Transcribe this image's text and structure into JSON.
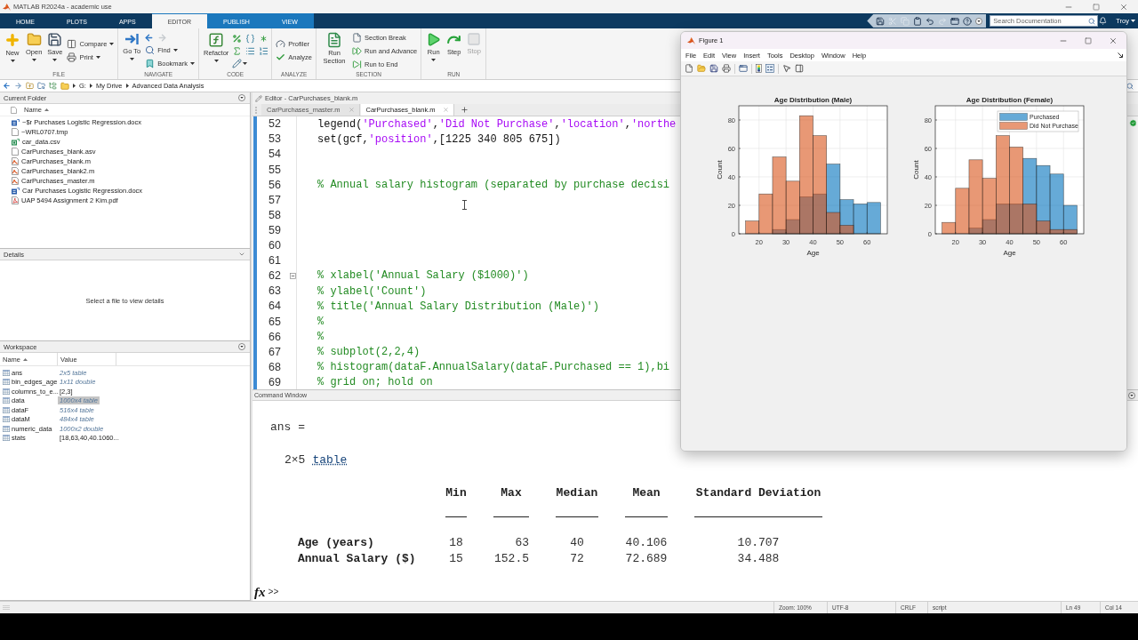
{
  "app_title": "MATLAB R2024a - academic use",
  "ribbon_tabs": [
    {
      "label": "HOME",
      "selected": false,
      "contextual": false
    },
    {
      "label": "PLOTS",
      "selected": false,
      "contextual": false
    },
    {
      "label": "APPS",
      "selected": false,
      "contextual": false
    },
    {
      "label": "EDITOR",
      "selected": true,
      "contextual": true
    },
    {
      "label": "PUBLISH",
      "selected": false,
      "contextual": true
    },
    {
      "label": "VIEW",
      "selected": false,
      "contextual": true
    }
  ],
  "quick_access": [
    {
      "disabled": false
    },
    {
      "disabled": true
    },
    {
      "disabled": true
    },
    {
      "disabled": false
    },
    {
      "disabled": false
    },
    {
      "disabled": true
    },
    {
      "disabled": false
    },
    {
      "disabled": false
    },
    {
      "disabled": false
    }
  ],
  "search": {
    "placeholder": "Search Documentation"
  },
  "user": "Troy",
  "toolstrip": [
    {
      "label": "FILE",
      "columns": [
        {
          "kind": "large",
          "button": {
            "label": "New",
            "dropdown": true,
            "disabled": false
          }
        },
        {
          "kind": "large",
          "button": {
            "label": "Open",
            "dropdown": true,
            "disabled": false
          }
        },
        {
          "kind": "large",
          "button": {
            "label": "Save",
            "dropdown": true,
            "disabled": false
          }
        },
        {
          "kind": "rows",
          "rows": [
            [
              {
                "label": "Compare",
                "dropdown": true,
                "disabled": false
              }
            ],
            [
              {
                "label": "Print",
                "dropdown": true,
                "disabled": false
              }
            ]
          ]
        }
      ]
    },
    {
      "label": "NAVIGATE",
      "columns": [
        {
          "kind": "large",
          "button": {
            "label": "Go To",
            "dropdown": true,
            "disabled": false
          }
        },
        {
          "kind": "rows",
          "rows": [
            [
              {
                "dropdown": false,
                "disabled": false
              },
              {
                "dropdown": false,
                "disabled": true
              }
            ],
            [
              {
                "label": "Find",
                "dropdown": true,
                "disabled": false
              }
            ],
            [
              {
                "label": "Bookmark",
                "dropdown": true,
                "disabled": false
              }
            ]
          ]
        }
      ]
    },
    {
      "label": "CODE",
      "columns": [
        {
          "kind": "large",
          "button": {
            "label": "Refactor",
            "dropdown": true,
            "disabled": false
          }
        },
        {
          "kind": "rows",
          "rows": [
            [
              {
                "dropdown": false,
                "disabled": false
              },
              {
                "dropdown": false,
                "disabled": false
              },
              {
                "dropdown": false,
                "disabled": false
              }
            ],
            [
              {
                "dropdown": false,
                "disabled": false
              },
              {
                "dropdown": false,
                "disabled": false
              },
              {
                "dropdown": false,
                "disabled": false
              }
            ],
            [
              {
                "dropdown": true,
                "disabled": false
              }
            ]
          ]
        }
      ]
    },
    {
      "label": "ANALYZE",
      "columns": [
        {
          "kind": "rows",
          "rows": [
            [
              {
                "label": "Profiler",
                "dropdown": false,
                "disabled": false
              }
            ],
            [
              {
                "label": "Analyze",
                "dropdown": false,
                "disabled": false
              }
            ]
          ]
        }
      ]
    },
    {
      "label": "SECTION",
      "columns": [
        {
          "kind": "large",
          "button": {
            "label": "Run Section",
            "dropdown": false,
            "disabled": false
          }
        },
        {
          "kind": "rows",
          "rows": [
            [
              {
                "label": "Section Break",
                "dropdown": false,
                "disabled": false
              }
            ],
            [
              {
                "label": "Run and Advance",
                "dropdown": false,
                "disabled": false
              }
            ],
            [
              {
                "label": "Run to End",
                "dropdown": false,
                "disabled": false
              }
            ]
          ]
        }
      ]
    },
    {
      "label": "RUN",
      "columns": [
        {
          "kind": "large",
          "button": {
            "label": "Run",
            "dropdown": true,
            "disabled": false
          }
        },
        {
          "kind": "large",
          "button": {
            "label": "Step",
            "dropdown": false,
            "disabled": false
          }
        },
        {
          "kind": "large",
          "button": {
            "label": "Stop",
            "dropdown": false,
            "disabled": true
          }
        }
      ]
    }
  ],
  "address_bar": {
    "path": [
      "G:",
      "My Drive",
      "Advanced Data Analysis"
    ]
  },
  "current_folder": {
    "title": "Current Folder",
    "column": "Name",
    "files": [
      {
        "name": "~$r Purchases Logistic Regression.docx",
        "kind": "docx"
      },
      {
        "name": "~WRL0707.tmp",
        "kind": "tmp"
      },
      {
        "name": "car_data.csv",
        "kind": "csv"
      },
      {
        "name": "CarPurchases_blank.asv",
        "kind": "asv"
      },
      {
        "name": "CarPurchases_blank.m",
        "kind": "m"
      },
      {
        "name": "CarPurchases_blank2.m",
        "kind": "m"
      },
      {
        "name": "CarPurchases_master.m",
        "kind": "m"
      },
      {
        "name": "Car Purchases Logistic Regression.docx",
        "kind": "docx"
      },
      {
        "name": "UAP 5494 Assignment 2 Kim.pdf",
        "kind": "pdf"
      }
    ]
  },
  "details": {
    "title": "Details",
    "message": "Select a file to view details"
  },
  "workspace": {
    "title": "Workspace",
    "columns": [
      "Name",
      "Value"
    ],
    "variables": [
      {
        "name": "ans",
        "value": "2x5 table",
        "kind": "summary",
        "selected": false
      },
      {
        "name": "bin_edges_age",
        "value": "1x11 double",
        "kind": "summary",
        "selected": false
      },
      {
        "name": "columns_to_e...",
        "value": "[2,3]",
        "kind": "value",
        "selected": false
      },
      {
        "name": "data",
        "value": "1000x4 table",
        "kind": "summary",
        "selected": true
      },
      {
        "name": "dataF",
        "value": "516x4 table",
        "kind": "summary",
        "selected": false
      },
      {
        "name": "dataM",
        "value": "484x4 table",
        "kind": "summary",
        "selected": false
      },
      {
        "name": "numeric_data",
        "value": "1000x2 double",
        "kind": "summary",
        "selected": false
      },
      {
        "name": "stats",
        "value": "[18,63,40,40.1060...",
        "kind": "value",
        "selected": false
      }
    ]
  },
  "editor": {
    "title": "Editor - CarPurchases_blank.m",
    "tabs": [
      {
        "label": "CarPurchases_master.m",
        "selected": false
      },
      {
        "label": "CarPurchases_blank.m",
        "selected": true
      }
    ],
    "lines": [
      {
        "number": "52",
        "fold_start": false,
        "tokens": [
          {
            "kind": "code",
            "text": "legend("
          },
          {
            "kind": "string",
            "text": "'Purchased'"
          },
          {
            "kind": "code",
            "text": ","
          },
          {
            "kind": "string",
            "text": "'Did Not Purchase'"
          },
          {
            "kind": "code",
            "text": ","
          },
          {
            "kind": "string",
            "text": "'location'"
          },
          {
            "kind": "code",
            "text": ","
          },
          {
            "kind": "string",
            "text": "'northe"
          }
        ]
      },
      {
        "number": "53",
        "fold_start": false,
        "tokens": [
          {
            "kind": "code",
            "text": "set(gcf,"
          },
          {
            "kind": "string",
            "text": "'position'"
          },
          {
            "kind": "code",
            "text": ",[1225 340 805 675])"
          }
        ]
      },
      {
        "number": "54",
        "fold_start": false
      },
      {
        "number": "55",
        "fold_start": false
      },
      {
        "number": "56",
        "fold_start": false,
        "tokens": [
          {
            "kind": "comment",
            "text": "% Annual salary histogram (separated by purchase decisi"
          }
        ]
      },
      {
        "number": "57",
        "fold_start": false
      },
      {
        "number": "58",
        "fold_start": false
      },
      {
        "number": "59",
        "fold_start": false
      },
      {
        "number": "60",
        "fold_start": false
      },
      {
        "number": "61",
        "fold_start": false
      },
      {
        "number": "62",
        "fold_start": true,
        "tokens": [
          {
            "kind": "comment",
            "text": "% xlabel('Annual Salary ($1000)')"
          }
        ]
      },
      {
        "number": "63",
        "fold_start": false,
        "tokens": [
          {
            "kind": "comment",
            "text": "% ylabel('Count')"
          }
        ]
      },
      {
        "number": "64",
        "fold_start": false,
        "tokens": [
          {
            "kind": "comment",
            "text": "% title('Annual Salary Distribution (Male)')"
          }
        ]
      },
      {
        "number": "65",
        "fold_start": false,
        "tokens": [
          {
            "kind": "comment",
            "text": "%"
          }
        ]
      },
      {
        "number": "66",
        "fold_start": false,
        "tokens": [
          {
            "kind": "comment",
            "text": "%"
          }
        ]
      },
      {
        "number": "67",
        "fold_start": false,
        "tokens": [
          {
            "kind": "comment",
            "text": "% subplot(2,2,4)"
          }
        ]
      },
      {
        "number": "68",
        "fold_start": false,
        "tokens": [
          {
            "kind": "comment",
            "text": "% histogram(dataF.AnnualSalary(dataF.Purchased == 1),bi"
          }
        ]
      },
      {
        "number": "69",
        "fold_start": false,
        "tokens": [
          {
            "kind": "comment",
            "text": "% grid on; hold on"
          }
        ]
      }
    ]
  },
  "command_window": {
    "title": "Command Window",
    "output": {
      "variable": "ans =",
      "size": "2×5",
      "class": "table",
      "table": {
        "columns": [
          "Min",
          "Max",
          "Median",
          "Mean",
          "Standard Deviation"
        ],
        "rows": [
          {
            "label": "Age (years)",
            "values": [
              "18",
              "63",
              "40",
              "40.106",
              "10.707"
            ]
          },
          {
            "label": "Annual Salary ($)",
            "values": [
              "15",
              "152.5",
              "72",
              "72.689",
              "34.488"
            ]
          }
        ]
      }
    },
    "function_button": "fx",
    "prompt": ">>"
  },
  "figure": {
    "title": "Figure 1",
    "menu": [
      "File",
      "Edit",
      "View",
      "Insert",
      "Tools",
      "Desktop",
      "Window",
      "Help"
    ],
    "chart_data": [
      {
        "type": "histogram",
        "title": "Age Distribution (Male)",
        "xlabel": "Age",
        "ylabel": "Count",
        "bins": [
          15,
          20,
          25,
          30,
          35,
          40,
          45,
          50,
          55,
          60,
          65
        ],
        "series": [
          {
            "color": "#0072bd",
            "values": [
              0,
              0,
              3,
              10,
              26,
              28,
              49,
              24,
              21,
              22
            ]
          },
          {
            "color": "#d95319",
            "values": [
              9,
              28,
              54,
              37,
              83,
              69,
              15,
              6,
              0,
              0
            ]
          }
        ],
        "xlim": [
          12.5,
          67.5
        ],
        "ylim": [
          0,
          90
        ],
        "xticks": [
          20,
          30,
          40,
          50,
          60
        ],
        "yticks": [
          0,
          20,
          40,
          60,
          80
        ],
        "grid": true
      },
      {
        "type": "histogram",
        "title": "Age Distribution (Female)",
        "xlabel": "Age",
        "ylabel": "Count",
        "bins": [
          15,
          20,
          25,
          30,
          35,
          40,
          45,
          50,
          55,
          60,
          65
        ],
        "series": [
          {
            "name": "Purchased",
            "color": "#0072bd",
            "values": [
              0,
              0,
              4,
              10,
              21,
              21,
              53,
              48,
              42,
              20
            ]
          },
          {
            "name": "Did Not Purchase",
            "color": "#d95319",
            "values": [
              8,
              32,
              52,
              39,
              69,
              61,
              21,
              9,
              3,
              3
            ]
          }
        ],
        "xlim": [
          12.5,
          67.5
        ],
        "ylim": [
          0,
          90
        ],
        "xticks": [
          20,
          30,
          40,
          50,
          60
        ],
        "yticks": [
          0,
          20,
          40,
          60,
          80
        ],
        "grid": true,
        "legend": "top right"
      }
    ]
  },
  "status_bar": [
    "Zoom: 100%",
    "UTF-8",
    "CRLF",
    "script",
    "Ln 49",
    "Col 14"
  ]
}
